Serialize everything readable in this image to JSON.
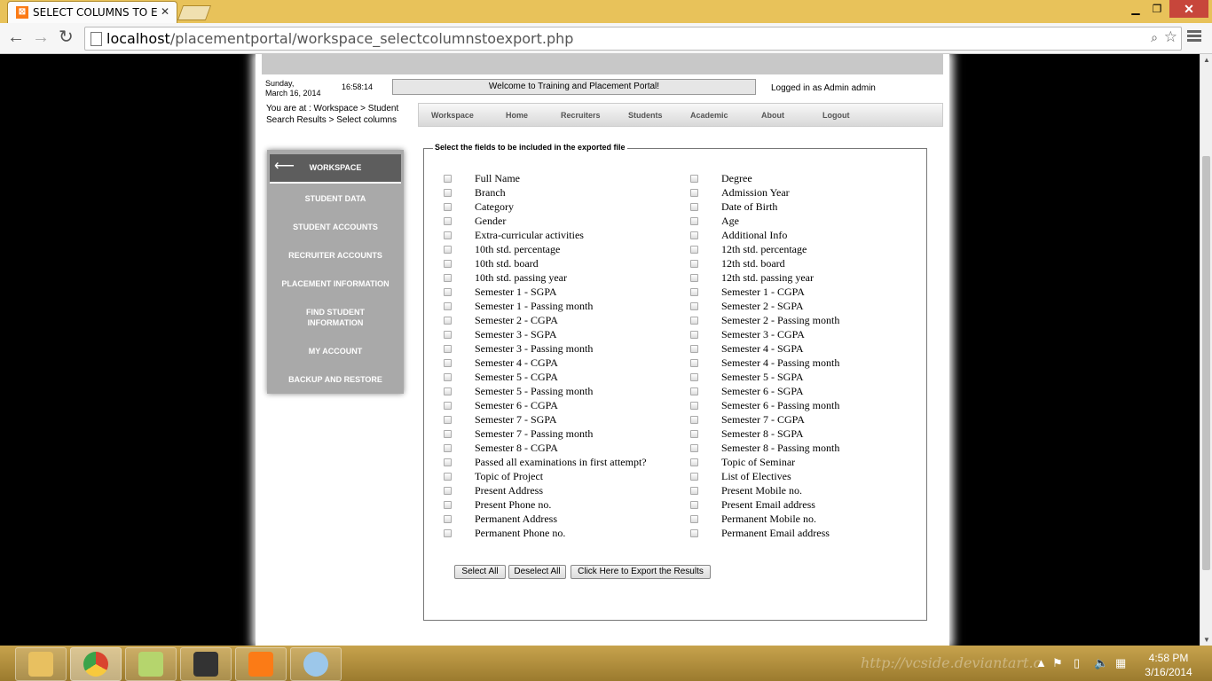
{
  "browser": {
    "tab_title": "SELECT COLUMNS TO EXI",
    "url_host": "localhost",
    "url_path": "/placementportal/workspace_selectcolumnstoexport.php"
  },
  "header": {
    "day": "Sunday,",
    "date": "March 16, 2014",
    "time": "16:58:14",
    "welcome": "Welcome to Training and Placement Portal!",
    "logged_in": "Logged in as Admin admin",
    "breadcrumb_line1": "You are at : Workspace > Student",
    "breadcrumb_line2": "Search Results > Select columns"
  },
  "nav": [
    "Workspace",
    "Home",
    "Recruiters",
    "Students",
    "Academic",
    "About",
    "Logout"
  ],
  "sidebar": {
    "head": "WORKSPACE",
    "items": [
      "STUDENT DATA",
      "STUDENT ACCOUNTS",
      "RECRUITER ACCOUNTS",
      "PLACEMENT INFORMATION",
      "FIND STUDENT INFORMATION",
      "MY ACCOUNT",
      "BACKUP AND RESTORE"
    ]
  },
  "form": {
    "legend": "Select the fields to be included in the exported file",
    "left_fields": [
      "Full Name",
      "Branch",
      "Category",
      "Gender",
      "Extra-curricular activities",
      "10th std. percentage",
      "10th std. board",
      "10th std. passing year",
      "Semester 1 - SGPA",
      "Semester 1 - Passing month",
      "Semester 2 - CGPA",
      "Semester 3 - SGPA",
      "Semester 3 - Passing month",
      "Semester 4 - CGPA",
      "Semester 5 - CGPA",
      "Semester 5 - Passing month",
      "Semester 6 - CGPA",
      "Semester 7 - SGPA",
      "Semester 7 - Passing month",
      "Semester 8 - CGPA",
      "Passed all examinations in first attempt?",
      "Topic of Project",
      "Present Address",
      "Present Phone no.",
      "Permanent Address",
      "Permanent Phone no."
    ],
    "right_fields": [
      "Degree",
      "Admission Year",
      "Date of Birth",
      "Age",
      "Additional Info",
      "12th std. percentage",
      "12th std. board",
      "12th std. passing year",
      "Semester 1 - CGPA",
      "Semester 2 - SGPA",
      "Semester 2 - Passing month",
      "Semester 3 - CGPA",
      "Semester 4 - SGPA",
      "Semester 4 - Passing month",
      "Semester 5 - SGPA",
      "Semester 6 - SGPA",
      "Semester 6 - Passing month",
      "Semester 7 - CGPA",
      "Semester 8 - SGPA",
      "Semester 8 - Passing month",
      "Topic of Seminar",
      "List of Electives",
      "Present Mobile no.",
      "Present Email address",
      "Permanent Mobile no.",
      "Permanent Email address"
    ],
    "select_all": "Select All",
    "deselect_all": "Deselect All",
    "export": "Click Here to Export the Results"
  },
  "taskbar": {
    "watermark": "http://vcside.deviantart.c",
    "time": "4:58 PM",
    "date": "3/16/2014"
  }
}
